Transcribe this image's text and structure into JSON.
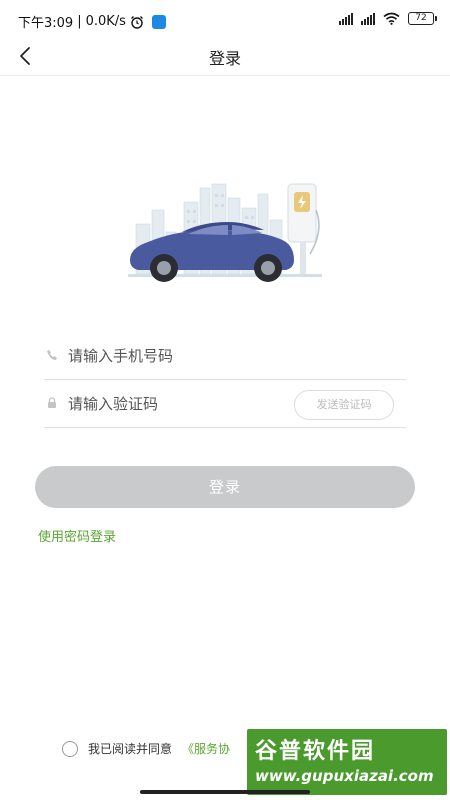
{
  "status_bar": {
    "time": "下午3:09",
    "separator": "|",
    "net_speed": "0.0K/s",
    "battery": "72",
    "icons": [
      "alarm-icon",
      "app-badge-icon",
      "signal-icon",
      "hd-signal-icon",
      "wifi-icon",
      "battery-icon"
    ]
  },
  "nav": {
    "title": "登录",
    "back_icon": "chevron-left-icon"
  },
  "form": {
    "phone_placeholder": "请输入手机号码",
    "code_placeholder": "请输入验证码",
    "send_code_label": "发送验证码",
    "login_label": "登录",
    "password_login_label": "使用密码登录"
  },
  "agreement": {
    "text": "我已阅读并同意",
    "link": "《服务协"
  },
  "watermark": {
    "title": "谷普软件园",
    "url": "www.gupuxiazai.com"
  },
  "colors": {
    "accent": "#5aa632",
    "button_disabled": "#c9cacc",
    "car_body": "#4a5a9e",
    "watermark_bg": "#4a9a2e"
  }
}
